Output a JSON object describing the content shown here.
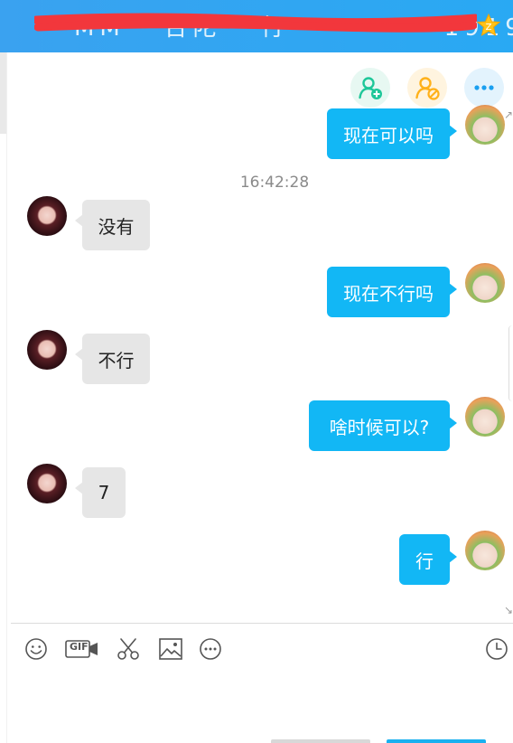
{
  "window": {
    "title": "MM · 台陀 · 行 ·········· 19191)"
  },
  "header_actions": [
    {
      "icon": "add-friend-icon",
      "color": "#1ec799"
    },
    {
      "icon": "remove-friend-icon",
      "color": "#ffb11a"
    },
    {
      "icon": "more-icon",
      "color": "#1a9ff0"
    }
  ],
  "messages": [
    {
      "from": "me",
      "text": "现在可以吗"
    },
    {
      "timestamp": "16:42:28"
    },
    {
      "from": "contact",
      "text": "没有"
    },
    {
      "from": "me",
      "text": "现在不行吗"
    },
    {
      "from": "contact",
      "text": "不行"
    },
    {
      "from": "me",
      "text": "啥时候可以?"
    },
    {
      "from": "contact",
      "text": "7"
    },
    {
      "from": "me",
      "text": "行"
    }
  ],
  "toolbar": {
    "icons": [
      "emoji-icon",
      "gif-icon",
      "screenshot-scissors-icon",
      "image-icon",
      "more-options-icon",
      "history-clock-icon"
    ],
    "gif_label": "GIF"
  },
  "colors": {
    "title_bar": "#29a9f3",
    "outgoing_bubble": "#12b7f5",
    "incoming_bubble": "#e6e6e6"
  }
}
